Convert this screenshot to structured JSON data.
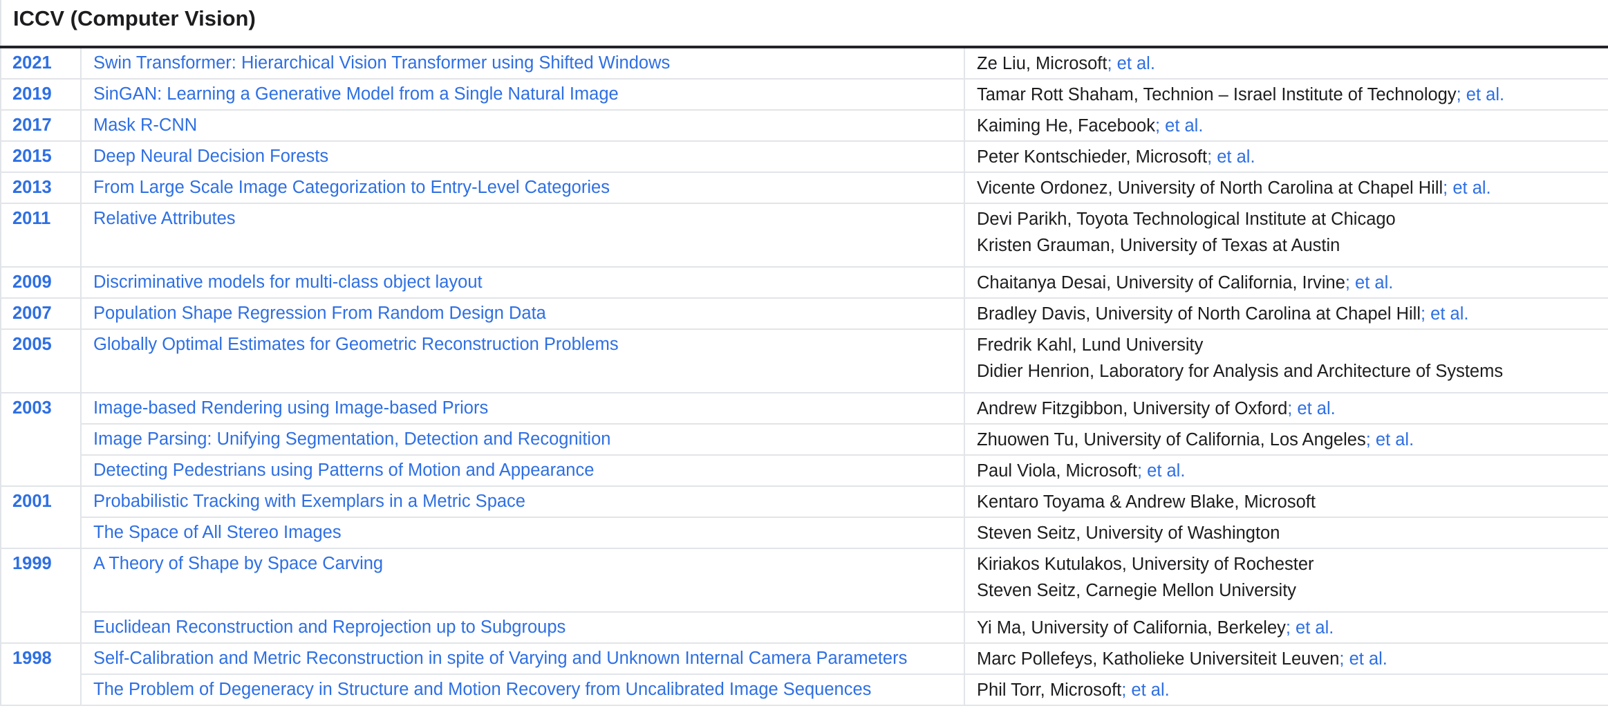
{
  "section": {
    "title": "ICCV (Computer Vision)"
  },
  "table": {
    "groups": [
      {
        "year": "2021",
        "papers": [
          {
            "title": "Swin Transformer: Hierarchical Vision Transformer using Shifted Windows",
            "authors": [
              "Ze Liu, Microsoft"
            ],
            "et_al": "; et al."
          }
        ]
      },
      {
        "year": "2019",
        "papers": [
          {
            "title": "SinGAN: Learning a Generative Model from a Single Natural Image",
            "authors": [
              "Tamar Rott Shaham, Technion – Israel Institute of Technology"
            ],
            "et_al": "; et al."
          }
        ]
      },
      {
        "year": "2017",
        "papers": [
          {
            "title": "Mask R-CNN",
            "authors": [
              "Kaiming He, Facebook"
            ],
            "et_al": "; et al."
          }
        ]
      },
      {
        "year": "2015",
        "papers": [
          {
            "title": "Deep Neural Decision Forests",
            "authors": [
              "Peter Kontschieder, Microsoft"
            ],
            "et_al": "; et al."
          }
        ]
      },
      {
        "year": "2013",
        "papers": [
          {
            "title": "From Large Scale Image Categorization to Entry-Level Categories",
            "authors": [
              "Vicente Ordonez, University of North Carolina at Chapel Hill"
            ],
            "et_al": "; et al."
          }
        ]
      },
      {
        "year": "2011",
        "papers": [
          {
            "title": "Relative Attributes",
            "authors": [
              "Devi Parikh, Toyota Technological Institute at Chicago",
              "Kristen Grauman, University of Texas at Austin"
            ],
            "et_al": ""
          }
        ]
      },
      {
        "year": "2009",
        "papers": [
          {
            "title": "Discriminative models for multi-class object layout",
            "authors": [
              "Chaitanya Desai, University of California, Irvine"
            ],
            "et_al": "; et al."
          }
        ]
      },
      {
        "year": "2007",
        "papers": [
          {
            "title": "Population Shape Regression From Random Design Data",
            "authors": [
              "Bradley Davis, University of North Carolina at Chapel Hill"
            ],
            "et_al": "; et al."
          }
        ]
      },
      {
        "year": "2005",
        "papers": [
          {
            "title": "Globally Optimal Estimates for Geometric Reconstruction Problems",
            "authors": [
              "Fredrik Kahl, Lund University",
              "Didier Henrion, Laboratory for Analysis and Architecture of Systems"
            ],
            "et_al": ""
          }
        ]
      },
      {
        "year": "2003",
        "papers": [
          {
            "title": "Image-based Rendering using Image-based Priors",
            "authors": [
              "Andrew Fitzgibbon, University of Oxford"
            ],
            "et_al": "; et al."
          },
          {
            "title": "Image Parsing: Unifying Segmentation, Detection and Recognition",
            "authors": [
              "Zhuowen Tu, University of California, Los Angeles"
            ],
            "et_al": "; et al."
          },
          {
            "title": "Detecting Pedestrians using Patterns of Motion and Appearance",
            "authors": [
              "Paul Viola, Microsoft"
            ],
            "et_al": "; et al."
          }
        ]
      },
      {
        "year": "2001",
        "papers": [
          {
            "title": "Probabilistic Tracking with Exemplars in a Metric Space",
            "authors": [
              "Kentaro Toyama & Andrew Blake, Microsoft"
            ],
            "et_al": ""
          },
          {
            "title": "The Space of All Stereo Images",
            "authors": [
              "Steven Seitz, University of Washington"
            ],
            "et_al": ""
          }
        ]
      },
      {
        "year": "1999",
        "papers": [
          {
            "title": "A Theory of Shape by Space Carving",
            "authors": [
              "Kiriakos Kutulakos, University of Rochester",
              "Steven Seitz, Carnegie Mellon University"
            ],
            "et_al": ""
          },
          {
            "title": "Euclidean Reconstruction and Reprojection up to Subgroups",
            "authors": [
              "Yi Ma, University of California, Berkeley"
            ],
            "et_al": "; et al."
          }
        ]
      },
      {
        "year": "1998",
        "papers": [
          {
            "title": "Self-Calibration and Metric Reconstruction in spite of Varying and Unknown Internal Camera Parameters",
            "authors": [
              "Marc Pollefeys, Katholieke Universiteit Leuven"
            ],
            "et_al": "; et al."
          },
          {
            "title": "The Problem of Degeneracy in Structure and Motion Recovery from Uncalibrated Image Sequences",
            "authors": [
              "Phil Torr, Microsoft"
            ],
            "et_al": "; et al."
          }
        ]
      }
    ]
  }
}
